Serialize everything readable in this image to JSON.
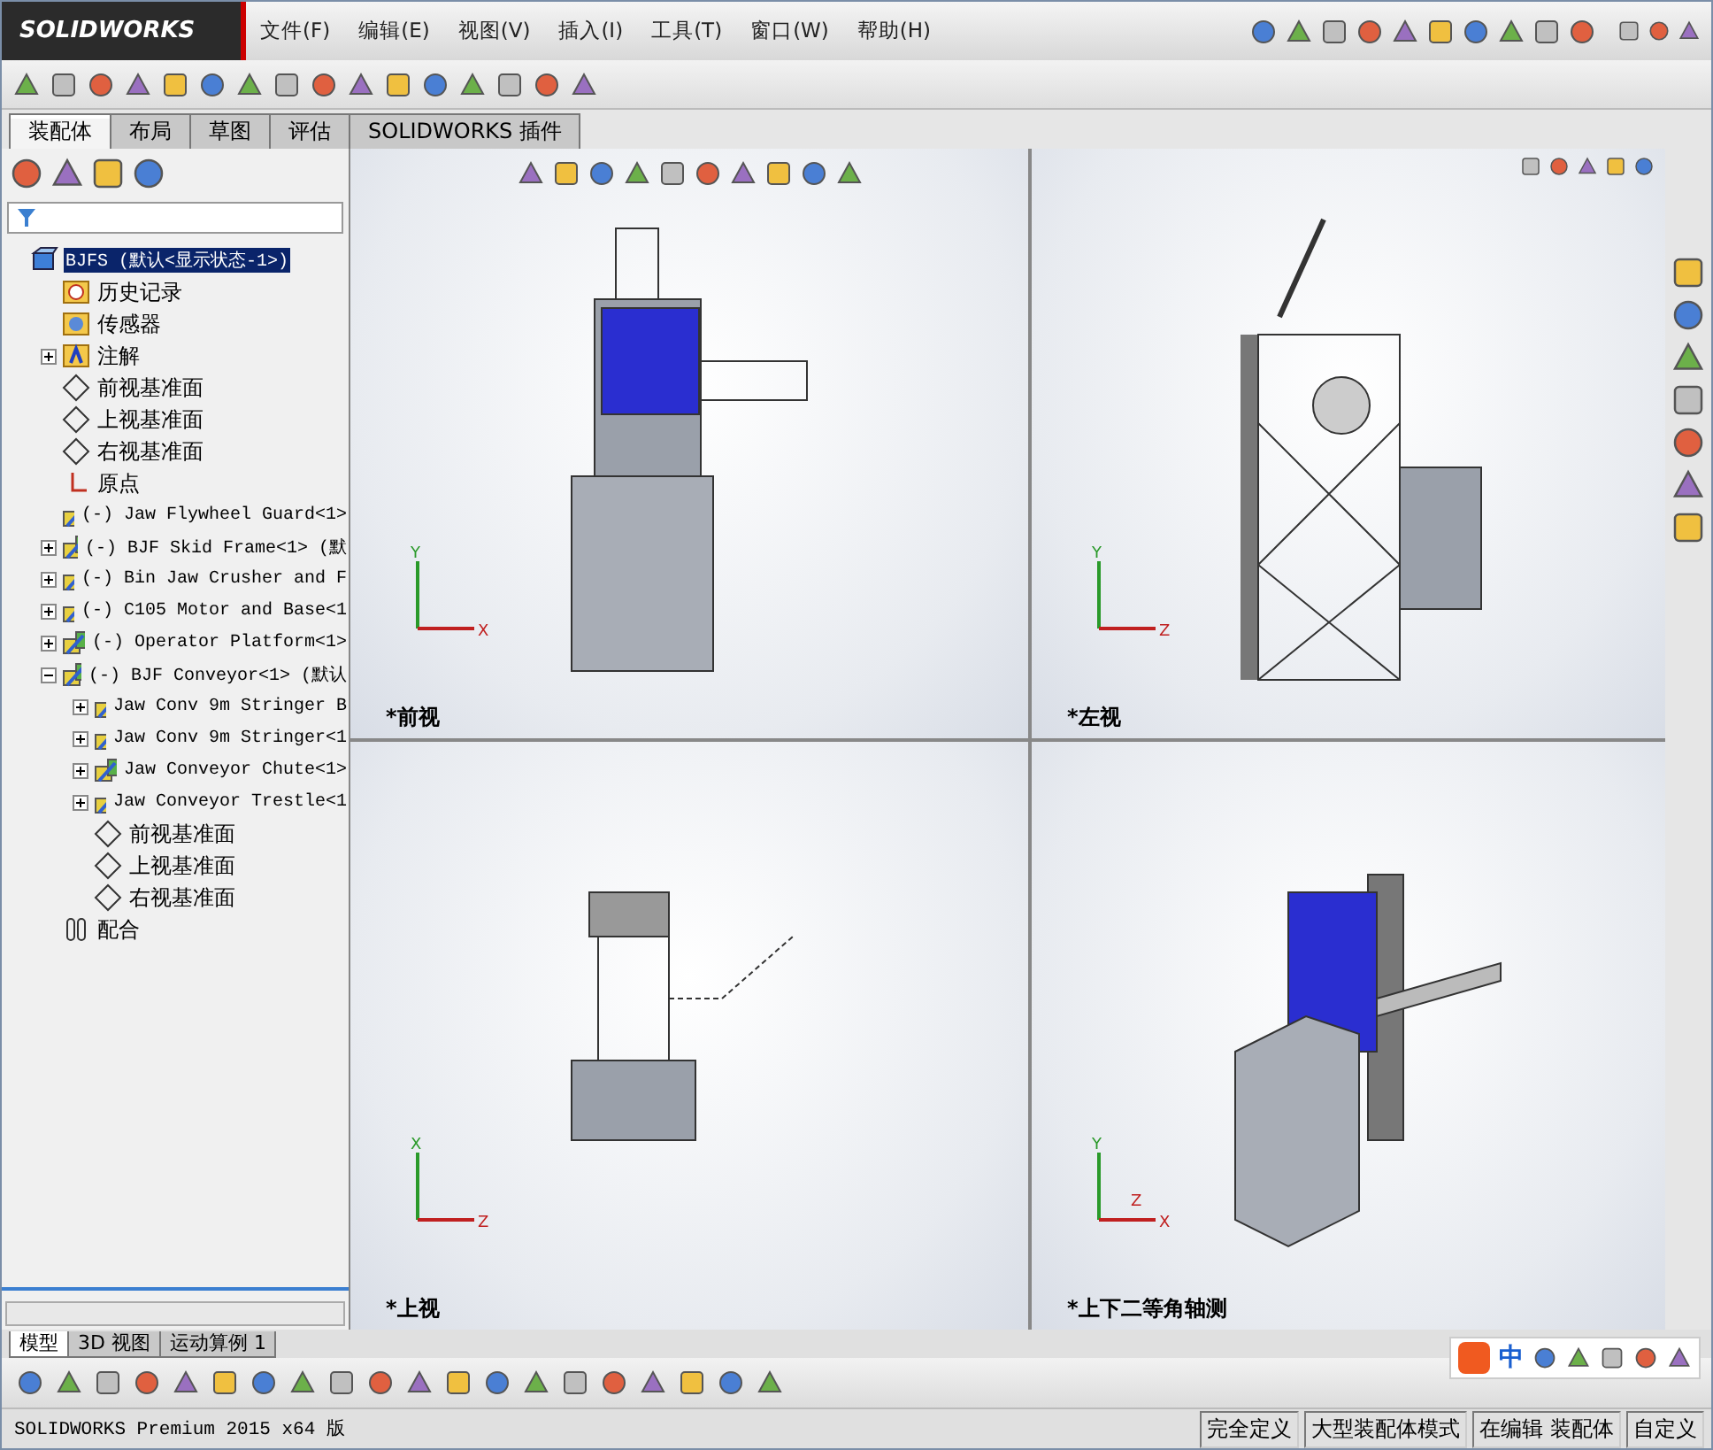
{
  "app": {
    "logo": "SOLIDWORKS"
  },
  "menu": [
    {
      "label": "文件(F)"
    },
    {
      "label": "编辑(E)"
    },
    {
      "label": "视图(V)"
    },
    {
      "label": "插入(I)"
    },
    {
      "label": "工具(T)"
    },
    {
      "label": "窗口(W)"
    },
    {
      "label": "帮助(H)"
    }
  ],
  "command_tabs": [
    {
      "label": "装配体",
      "selected": true
    },
    {
      "label": "布局",
      "selected": false
    },
    {
      "label": "草图",
      "selected": false
    },
    {
      "label": "评估",
      "selected": false
    },
    {
      "label": "SOLIDWORKS 插件",
      "selected": false
    }
  ],
  "tree": [
    {
      "label": "BJFS  (默认<显示状态-1>)",
      "kind": "assembly",
      "selected": true,
      "children": [
        {
          "label": "历史记录",
          "kind": "history",
          "selected": false
        },
        {
          "label": "传感器",
          "kind": "sensor",
          "selected": false
        },
        {
          "label": "注解",
          "kind": "annotation",
          "selected": false,
          "expanded": false
        },
        {
          "label": "前视基准面",
          "kind": "plane",
          "selected": false
        },
        {
          "label": "上视基准面",
          "kind": "plane",
          "selected": false
        },
        {
          "label": "右视基准面",
          "kind": "plane",
          "selected": false
        },
        {
          "label": "原点",
          "kind": "origin",
          "selected": false
        },
        {
          "label": "(-) Jaw Flywheel Guard<1>",
          "kind": "part",
          "selected": false
        },
        {
          "label": "(-) BJF Skid Frame<1> (默",
          "kind": "part",
          "selected": false,
          "expanded": false
        },
        {
          "label": "(-) Bin Jaw Crusher and F",
          "kind": "part",
          "selected": false,
          "expanded": false
        },
        {
          "label": "(-) C105 Motor and Base<1",
          "kind": "part",
          "selected": false,
          "expanded": false
        },
        {
          "label": "(-) Operator Platform<1>",
          "kind": "part",
          "selected": false,
          "expanded": false
        },
        {
          "label": "(-) BJF Conveyor<1> (默认",
          "kind": "part",
          "selected": false,
          "expanded": true,
          "children": [
            {
              "label": "Jaw Conv 9m Stringer B",
              "kind": "part",
              "selected": false,
              "expanded": false
            },
            {
              "label": "Jaw Conv 9m Stringer<1",
              "kind": "part",
              "selected": false,
              "expanded": false
            },
            {
              "label": "Jaw Conveyor Chute<1>",
              "kind": "part",
              "selected": false,
              "expanded": false
            },
            {
              "label": "Jaw Conveyor Trestle<1",
              "kind": "part",
              "selected": false,
              "expanded": false
            },
            {
              "label": "前视基准面",
              "kind": "plane",
              "selected": false
            },
            {
              "label": "上视基准面",
              "kind": "plane",
              "selected": false
            },
            {
              "label": "右视基准面",
              "kind": "plane",
              "selected": false
            }
          ]
        },
        {
          "label": "配合",
          "kind": "mates",
          "selected": false
        }
      ]
    }
  ],
  "viewports": [
    {
      "label": "*前视",
      "kind": "front",
      "axes": [
        "Y",
        "X"
      ]
    },
    {
      "label": "*左视",
      "kind": "left",
      "axes": [
        "Y",
        "Z"
      ]
    },
    {
      "label": "*上视",
      "kind": "top",
      "axes": [
        "X",
        "Z"
      ]
    },
    {
      "label": "*上下二等角轴测",
      "kind": "iso",
      "axes": [
        "Y",
        "X",
        "Z"
      ]
    }
  ],
  "bottom_tabs": [
    {
      "label": "模型",
      "selected": true
    },
    {
      "label": "3D 视图",
      "selected": false
    },
    {
      "label": "运动算例 1",
      "selected": false
    }
  ],
  "ime": {
    "label": "中"
  },
  "status_bar": [
    {
      "label": "SOLIDWORKS Premium 2015 x64 版"
    },
    {
      "label": "完全定义"
    },
    {
      "label": "大型装配体模式"
    },
    {
      "label": "在编辑 装配体"
    },
    {
      "label": "自定义"
    }
  ]
}
